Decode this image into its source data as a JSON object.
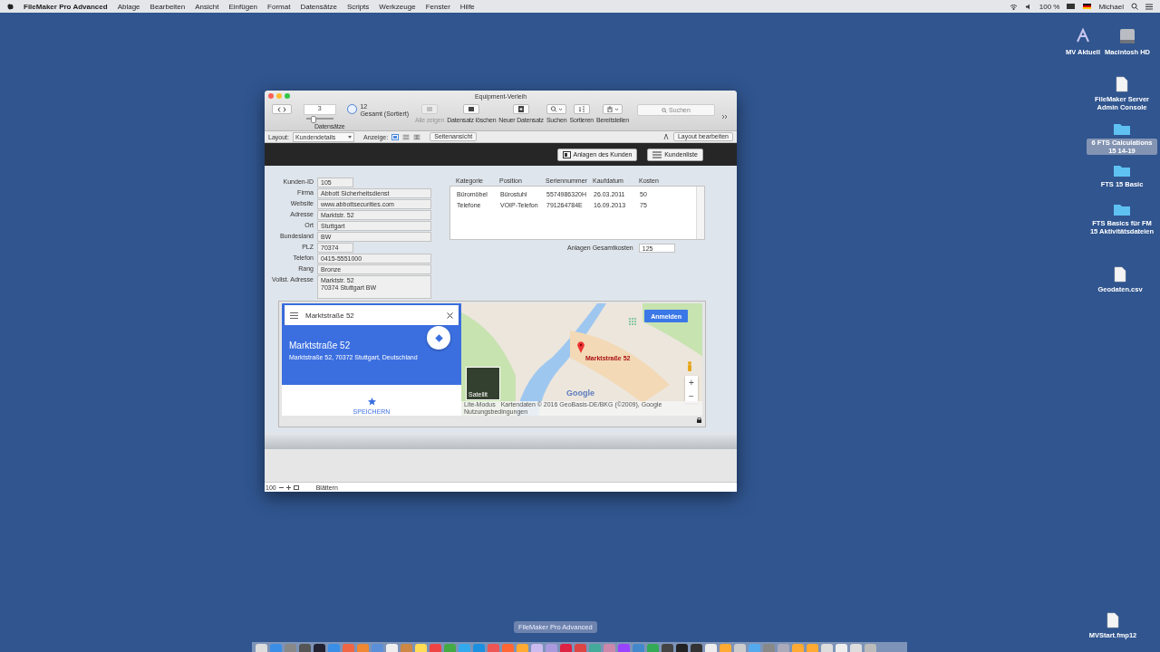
{
  "menubar": {
    "app_name": "FileMaker Pro Advanced",
    "items": [
      "Ablage",
      "Bearbeiten",
      "Ansicht",
      "Einfügen",
      "Format",
      "Datensätze",
      "Scripts",
      "Werkzeuge",
      "Fenster",
      "Hilfe"
    ],
    "battery": "100 %",
    "user": "Michael"
  },
  "window": {
    "title": "Equipment-Verleih",
    "toolbar": {
      "record_number": "3",
      "level": 0.25,
      "found_count": "12",
      "found_label": "Gesamt (Sortiert)",
      "records_label": "Datensätze",
      "search_placeholder": "Suchen",
      "buttons": [
        {
          "label": "Alle zeigen",
          "kind": "records",
          "disabled": true
        },
        {
          "label": "Datensatz löschen",
          "kind": "delete",
          "disabled": false
        },
        {
          "label": "Neuer Datensatz",
          "kind": "new",
          "disabled": false
        },
        {
          "label": "Suchen",
          "kind": "find",
          "disabled": false
        },
        {
          "label": "Sortieren",
          "kind": "sort",
          "disabled": false
        },
        {
          "label": "Bereitstellen",
          "kind": "share",
          "disabled": false
        }
      ]
    },
    "layout_bar": {
      "layout_label": "Layout:",
      "layout_value": "Kundendetails",
      "view_label": "Anzeige:",
      "view_modes": [
        {
          "kind": "form",
          "selected": true
        },
        {
          "kind": "list",
          "selected": false
        },
        {
          "kind": "table",
          "selected": false
        }
      ],
      "preview_button": "Seitenansicht",
      "edit_button": "Layout bearbeiten"
    },
    "header_buttons": [
      {
        "label": "Anlagen des Kunden",
        "kind": "record"
      },
      {
        "label": "Kundenliste",
        "kind": "list"
      }
    ],
    "fields": [
      {
        "label": "Kunden-ID",
        "value": "105",
        "kind": "short"
      },
      {
        "label": "Firma",
        "value": "Abbott Sicherheitsdienst",
        "kind": "long"
      },
      {
        "label": "Website",
        "value": "www.abbottsecurities.com",
        "kind": "long"
      },
      {
        "label": "Adresse",
        "value": "Marktstr. 52",
        "kind": "long"
      },
      {
        "label": "Ort",
        "value": "Stuttgart",
        "kind": "long"
      },
      {
        "label": "Bundesland",
        "value": "BW",
        "kind": "long"
      },
      {
        "label": "PLZ",
        "value": "70374",
        "kind": "short"
      },
      {
        "label": "Telefon",
        "value": "0415-5551000",
        "kind": "long"
      },
      {
        "label": "Rang",
        "value": "Bronze",
        "kind": "long"
      },
      {
        "label": "Vollst. Adresse",
        "value": "Marktstr. 52\n70374 Stuttgart BW",
        "kind": "multi"
      }
    ],
    "portal": {
      "columns": [
        "Kategorie",
        "Position",
        "Seriennummer",
        "Kaufdatum",
        "Kosten"
      ],
      "rows": [
        [
          "Büromöbel",
          "Bürostuhl",
          "5574986320H",
          "26.03.2011",
          "50"
        ],
        [
          "Telefone",
          "VOIP-Telefon",
          "791264784E",
          "16.09.2013",
          "75"
        ]
      ]
    },
    "total": {
      "label": "Anlagen Gesamtkosten",
      "value": "125"
    },
    "map": {
      "search_value": "Marktstraße 52",
      "place_title": "Marktstraße 52",
      "place_address": "Marktstraße 52, 70372 Stuttgart, Deutschland",
      "save_label": "SPEICHERN",
      "sign_in": "Anmelden",
      "marker_label": "Marktstraße 52",
      "satellite_label": "Satellit",
      "logo": "Google",
      "zoom_in": "+",
      "zoom_out": "−",
      "footer": [
        "Lite-Modus",
        "Kartendaten © 2016 GeoBasis-DE/BKG (©2009), Google",
        "Nutzungsbedingungen"
      ]
    },
    "status_bar": {
      "zoom": "100",
      "mode": "Blättern"
    }
  },
  "desktop_icons": [
    {
      "label": "MV Aktuell",
      "kind": "app",
      "selected": false
    },
    {
      "label": "Macintosh HD",
      "kind": "drive",
      "selected": false
    },
    {
      "label": "FileMaker Server Admin Console",
      "kind": "document",
      "selected": false
    },
    {
      "label": "6 FTS Calculations 15 14-19",
      "kind": "folder",
      "selected": true
    },
    {
      "label": "FTS 15 Basic",
      "kind": "folder",
      "selected": false
    },
    {
      "label": "FTS Basics für FM 15 Aktivitätsdateien",
      "kind": "folder",
      "selected": false
    },
    {
      "label": "Geodaten.csv",
      "kind": "document",
      "selected": false
    },
    {
      "label": "MVStart.fmp12",
      "kind": "document",
      "selected": false
    }
  ],
  "dock": {
    "tooltip": "FileMaker Pro Advanced"
  }
}
